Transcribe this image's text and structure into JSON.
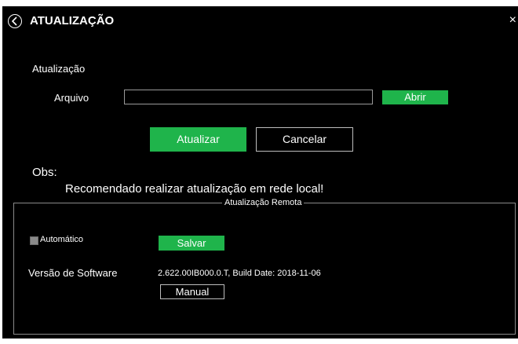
{
  "header": {
    "title": "ATUALIZAÇÃO",
    "back_icon": "chevron-left-circle-icon",
    "close_icon": "close-icon",
    "close_glyph": "×"
  },
  "update": {
    "section_label": "Atualização",
    "file_label": "Arquivo",
    "file_value": "",
    "open_label": "Abrir",
    "update_label": "Atualizar",
    "cancel_label": "Cancelar"
  },
  "note": {
    "label": "Obs:",
    "text": "Recomendado realizar atualização em rede local!"
  },
  "remote": {
    "legend": "Atualização Remota",
    "auto_label": "Automático",
    "auto_checked": false,
    "save_label": "Salvar",
    "version_label": "Versão de Software",
    "version_value": "2.622.00IB000.0.T, Build Date: 2018-11-06",
    "manual_label": "Manual"
  },
  "colors": {
    "accent": "#1fb44b",
    "background": "#000000",
    "text": "#ffffff"
  }
}
